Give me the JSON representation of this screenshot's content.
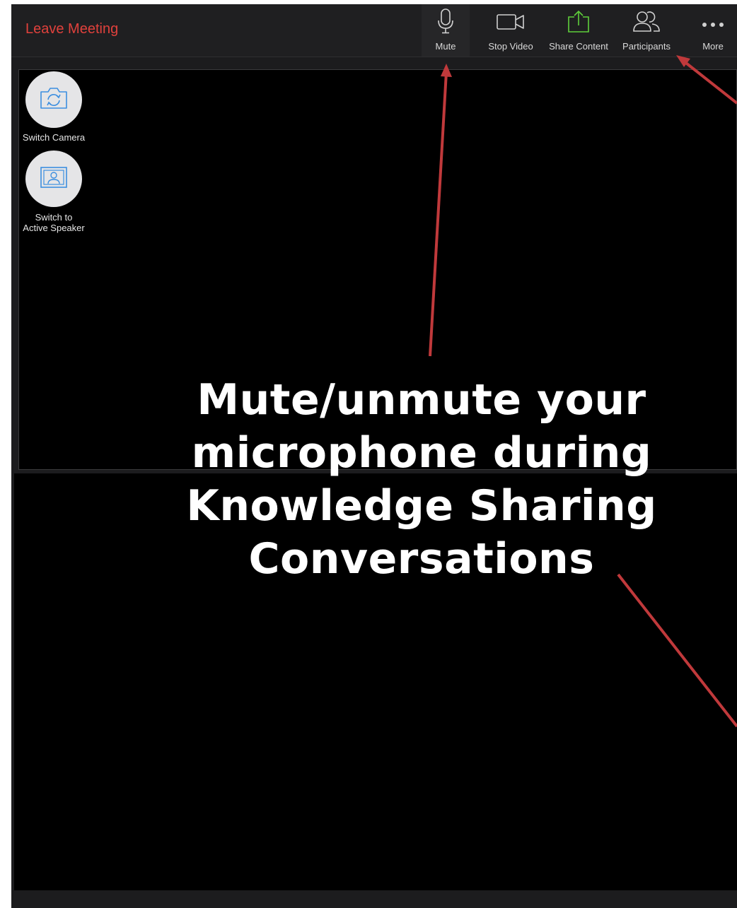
{
  "toolbar": {
    "leave_label": "Leave Meeting",
    "mute_label": "Mute",
    "video_label": "Stop Video",
    "share_label": "Share Content",
    "participants_label": "Participants",
    "more_label": "More"
  },
  "side_controls": {
    "switch_camera_label": "Switch Camera",
    "active_speaker_label_line1": "Switch to",
    "active_speaker_label_line2": "Active Speaker"
  },
  "annotation": {
    "caption_line1": "Mute/unmute your",
    "caption_line2": "microphone during",
    "caption_line3": "Knowledge Sharing",
    "caption_line4": "Conversations"
  },
  "colors": {
    "leave": "#e0413c",
    "share_icon": "#5fcf3b",
    "accent_icon": "#3d8fe0",
    "arrow": "#c0393b"
  },
  "icons": {
    "mute": "microphone-icon",
    "video": "video-camera-icon",
    "share": "share-upload-icon",
    "participants": "participants-icon",
    "more": "ellipsis-icon",
    "switch_camera": "camera-switch-icon",
    "active_speaker": "speaker-view-icon"
  }
}
